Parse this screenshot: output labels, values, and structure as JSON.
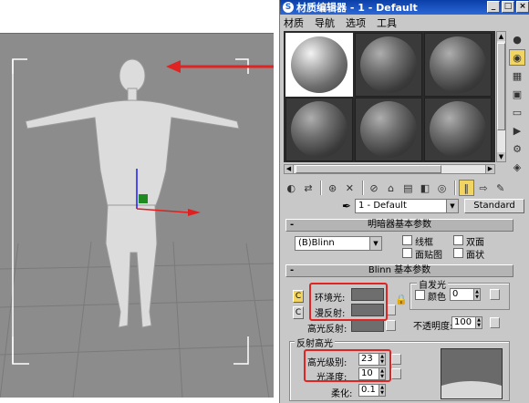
{
  "window": {
    "title": "材质编辑器 - 1 - Default",
    "controls": {
      "minimize": "_",
      "maximize": "□",
      "close": "×"
    }
  },
  "menu": [
    "材质",
    "导航",
    "选项",
    "工具"
  ],
  "material_slots": {
    "count": 6,
    "active_index": 0
  },
  "name_row": {
    "material_name": "1 - Default",
    "type_button": "Standard"
  },
  "rollouts": {
    "shader_basic": {
      "title": "明暗器基本参数",
      "shader": "(B)Blinn",
      "options": [
        "线框",
        "双面",
        "面贴图",
        "面状"
      ]
    },
    "blinn_basic": {
      "title": "Blinn 基本参数",
      "self_illum_title": "自发光",
      "ambient_label": "环境光:",
      "diffuse_label": "漫反射:",
      "specular_label": "高光反射:",
      "color_label": "颜色",
      "color_value": "0",
      "opacity_label": "不透明度:",
      "opacity_value": "100",
      "lock_letters": [
        "C",
        "C"
      ]
    },
    "specular_highlights": {
      "title": "反射高光",
      "level_label": "高光级别:",
      "level_value": "23",
      "gloss_label": "光泽度:",
      "gloss_value": "10",
      "soften_label": "柔化:",
      "soften_value": "0.1"
    }
  },
  "icons": {
    "side_toolbar": [
      "sample-type-sphere-icon",
      "backlight-icon",
      "background-checker-icon",
      "sample-uv-tiling-icon",
      "video-color-check-icon",
      "make-preview-icon",
      "options-icon",
      "select-by-material-icon",
      "material-map-navigator-icon"
    ],
    "bottom_toolbar": [
      "get-material-icon",
      "put-to-scene-icon",
      "assign-to-selection-icon",
      "reset-map-icon",
      "make-unique-icon",
      "put-to-library-icon",
      "material-effects-channel-icon",
      "show-map-in-viewport-icon",
      "show-end-result-icon",
      "go-to-parent-icon",
      "go-forward-sibling-icon",
      "pick-material-icon"
    ]
  },
  "colors": {
    "titlebar": "#0b3fa8",
    "panel": "#c8c8c8",
    "highlight": "#e02424",
    "viewport": "#8c8c8c",
    "active_tool": "#f2d460"
  }
}
